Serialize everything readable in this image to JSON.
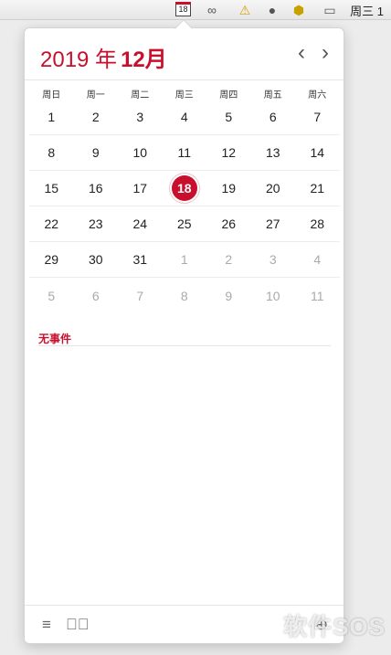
{
  "menubar": {
    "calendar_icon_date": "18",
    "time": "周三 1"
  },
  "header": {
    "year": "2019 年",
    "month": "12月"
  },
  "weekdays": [
    "周日",
    "周一",
    "周二",
    "周三",
    "周四",
    "周五",
    "周六"
  ],
  "weeks": [
    [
      {
        "d": "1"
      },
      {
        "d": "2"
      },
      {
        "d": "3"
      },
      {
        "d": "4"
      },
      {
        "d": "5"
      },
      {
        "d": "6"
      },
      {
        "d": "7"
      }
    ],
    [
      {
        "d": "8"
      },
      {
        "d": "9"
      },
      {
        "d": "10"
      },
      {
        "d": "11"
      },
      {
        "d": "12"
      },
      {
        "d": "13"
      },
      {
        "d": "14"
      }
    ],
    [
      {
        "d": "15"
      },
      {
        "d": "16"
      },
      {
        "d": "17"
      },
      {
        "d": "18",
        "today": true
      },
      {
        "d": "19"
      },
      {
        "d": "20"
      },
      {
        "d": "21"
      }
    ],
    [
      {
        "d": "22"
      },
      {
        "d": "23"
      },
      {
        "d": "24"
      },
      {
        "d": "25"
      },
      {
        "d": "26"
      },
      {
        "d": "27"
      },
      {
        "d": "28"
      }
    ],
    [
      {
        "d": "29"
      },
      {
        "d": "30"
      },
      {
        "d": "31"
      },
      {
        "d": "1",
        "other": true
      },
      {
        "d": "2",
        "other": true
      },
      {
        "d": "3",
        "other": true
      },
      {
        "d": "4",
        "other": true
      }
    ],
    [
      {
        "d": "5",
        "other": true
      },
      {
        "d": "6",
        "other": true
      },
      {
        "d": "7",
        "other": true
      },
      {
        "d": "8",
        "other": true
      },
      {
        "d": "9",
        "other": true
      },
      {
        "d": "10",
        "other": true
      },
      {
        "d": "11",
        "other": true
      }
    ]
  ],
  "events": {
    "empty_label": "无事件"
  },
  "watermark": "软件SOS",
  "colors": {
    "accent": "#c8102e"
  }
}
